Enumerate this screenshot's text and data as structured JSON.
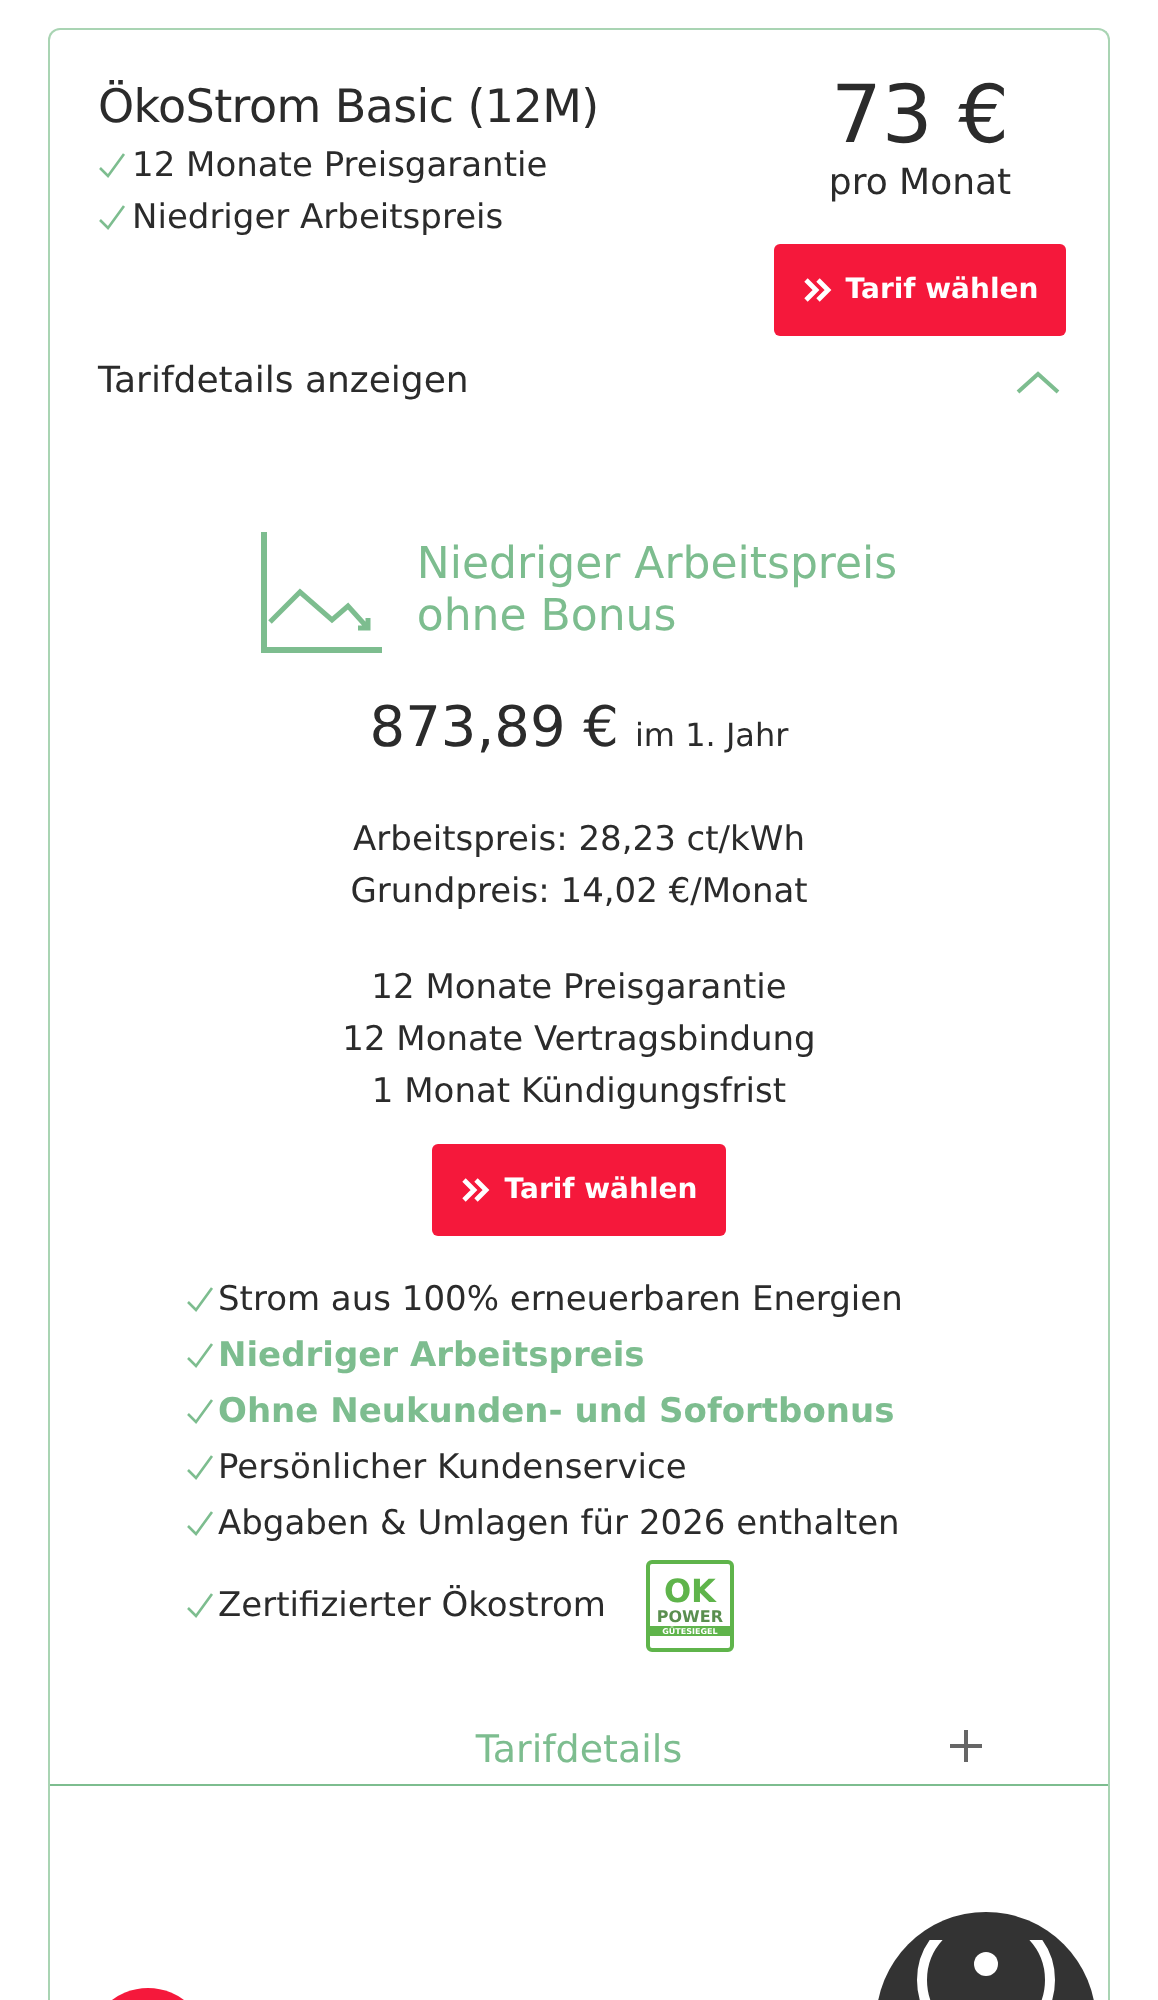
{
  "tariff": {
    "name": "ÖkoStrom Basic (12M)",
    "price": "73 €",
    "price_unit": "pro Monat",
    "highlights": [
      "12 Monate Preisgarantie",
      "Niedriger Arbeitspreis"
    ],
    "button": "Tarif wählen"
  },
  "details_toggle": {
    "label": "Tarifdetails anzeigen",
    "expanded": true
  },
  "details": {
    "headline_lines": [
      "Niedriger Arbeitspreis",
      "ohne Bonus"
    ],
    "annual_price": "873,89 €",
    "annual_note": "im 1. Jahr",
    "prices": [
      "Arbeitspreis: 28,23 ct/kWh",
      "Grundpreis: 14,02 €/Monat"
    ],
    "terms": [
      "12 Monate Preisgarantie",
      "12 Monate Vertragsbindung",
      "1 Monat Kündigungsfrist"
    ],
    "button": "Tarif wählen",
    "features": [
      {
        "text": "Strom aus 100% erneuerbaren Energien",
        "highlighted": false
      },
      {
        "text": "Niedriger Arbeitspreis",
        "highlighted": true
      },
      {
        "text": "Ohne Neukunden- und Sofortbonus",
        "highlighted": true
      },
      {
        "text": "Persönlicher Kundenservice",
        "highlighted": false
      },
      {
        "text": "Abgaben & Umlagen für 2026 enthalten",
        "highlighted": false
      },
      {
        "text": "Zertifizierter Ökostrom",
        "highlighted": false,
        "seal": {
          "top": "OK",
          "middle": "POWER",
          "bottom": "GÜTESIEGEL"
        }
      }
    ]
  },
  "section": {
    "label": "Tarifdetails",
    "expanded": false
  }
}
